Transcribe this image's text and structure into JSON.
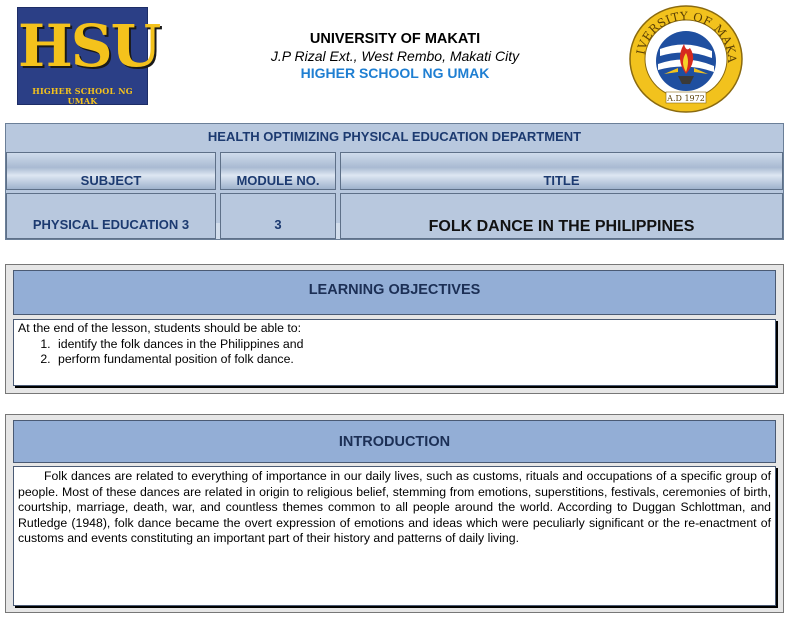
{
  "header": {
    "logo_main": "HSU",
    "logo_sub": "Higher School ng UMak",
    "title": "UNIVERSITY OF MAKATI",
    "address": "J.P Rizal Ext., West Rembo, Makati City",
    "school": "HIGHER SCHOOL NG UMAK",
    "seal_text_top": "UNIVERSITY OF MAKATI",
    "seal_text_bottom": "A.D 1972"
  },
  "department": {
    "title": "HEALTH OPTIMIZING PHYSICAL EDUCATION DEPARTMENT",
    "columns": [
      "SUBJECT",
      "MODULE NO.",
      "TITLE"
    ],
    "subject": "PHYSICAL EDUCATION 3",
    "module_no": "3",
    "module_title": "FOLK DANCE IN THE PHILIPPINES"
  },
  "objectives": {
    "heading": "LEARNING OBJECTIVES",
    "intro": "At the end of the lesson, students should be able to:",
    "items": [
      "identify the folk dances in the Philippines and",
      "perform fundamental position of folk dance."
    ]
  },
  "introduction": {
    "heading": "INTRODUCTION",
    "text": "Folk dances are related to everything of importance in our daily lives, such as customs, rituals and occupations of a specific group of people. Most of these dances are related in origin to religious belief, stemming from emotions, superstitions, festivals, ceremonies of birth, courtship, marriage, death, war, and countless themes common to all people around the world. According to Duggan Schlottman, and Rutledge (1948), folk dance became the overt expression of emotions and ideas which were peculiarly significant or the re-enactment of customs and events constituting an important part of their history and patterns of daily living."
  },
  "colors": {
    "header_blue": "#93aed6",
    "dept_blue": "#b8c8de",
    "school_text": "#1f7fd2",
    "logo_bg": "#2b3f86",
    "logo_gold": "#f4c21c"
  }
}
